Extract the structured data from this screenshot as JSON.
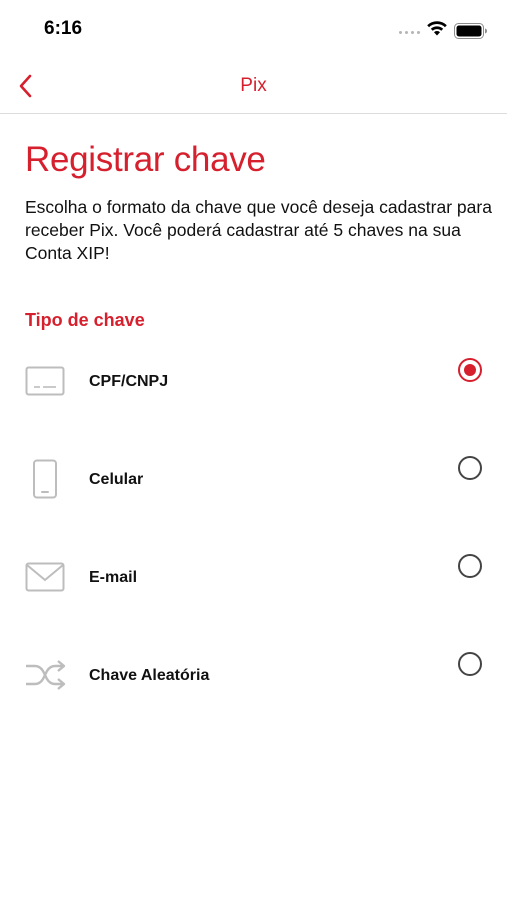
{
  "status_bar": {
    "time": "6:16",
    "icons": [
      "signal-dots-icon",
      "wifi-icon",
      "battery-icon"
    ]
  },
  "nav": {
    "back_icon": "chevron-left-icon",
    "title": "Pix"
  },
  "page": {
    "title": "Registrar chave",
    "description": "Escolha o formato da chave que você deseja cadastrar para receber Pix. Você poderá cadastrar até 5 chaves na sua Conta XIP!",
    "section_label": "Tipo de chave"
  },
  "key_types": [
    {
      "label": "CPF/CNPJ",
      "icon": "id-card-icon",
      "selected": true
    },
    {
      "label": "Celular",
      "icon": "phone-icon",
      "selected": false
    },
    {
      "label": "E-mail",
      "icon": "envelope-icon",
      "selected": false
    },
    {
      "label": "Chave Aleatória",
      "icon": "shuffle-icon",
      "selected": false
    }
  ],
  "colors": {
    "accent": "#d6202e",
    "icon_gray": "#bdbdbd",
    "text": "#111111"
  }
}
